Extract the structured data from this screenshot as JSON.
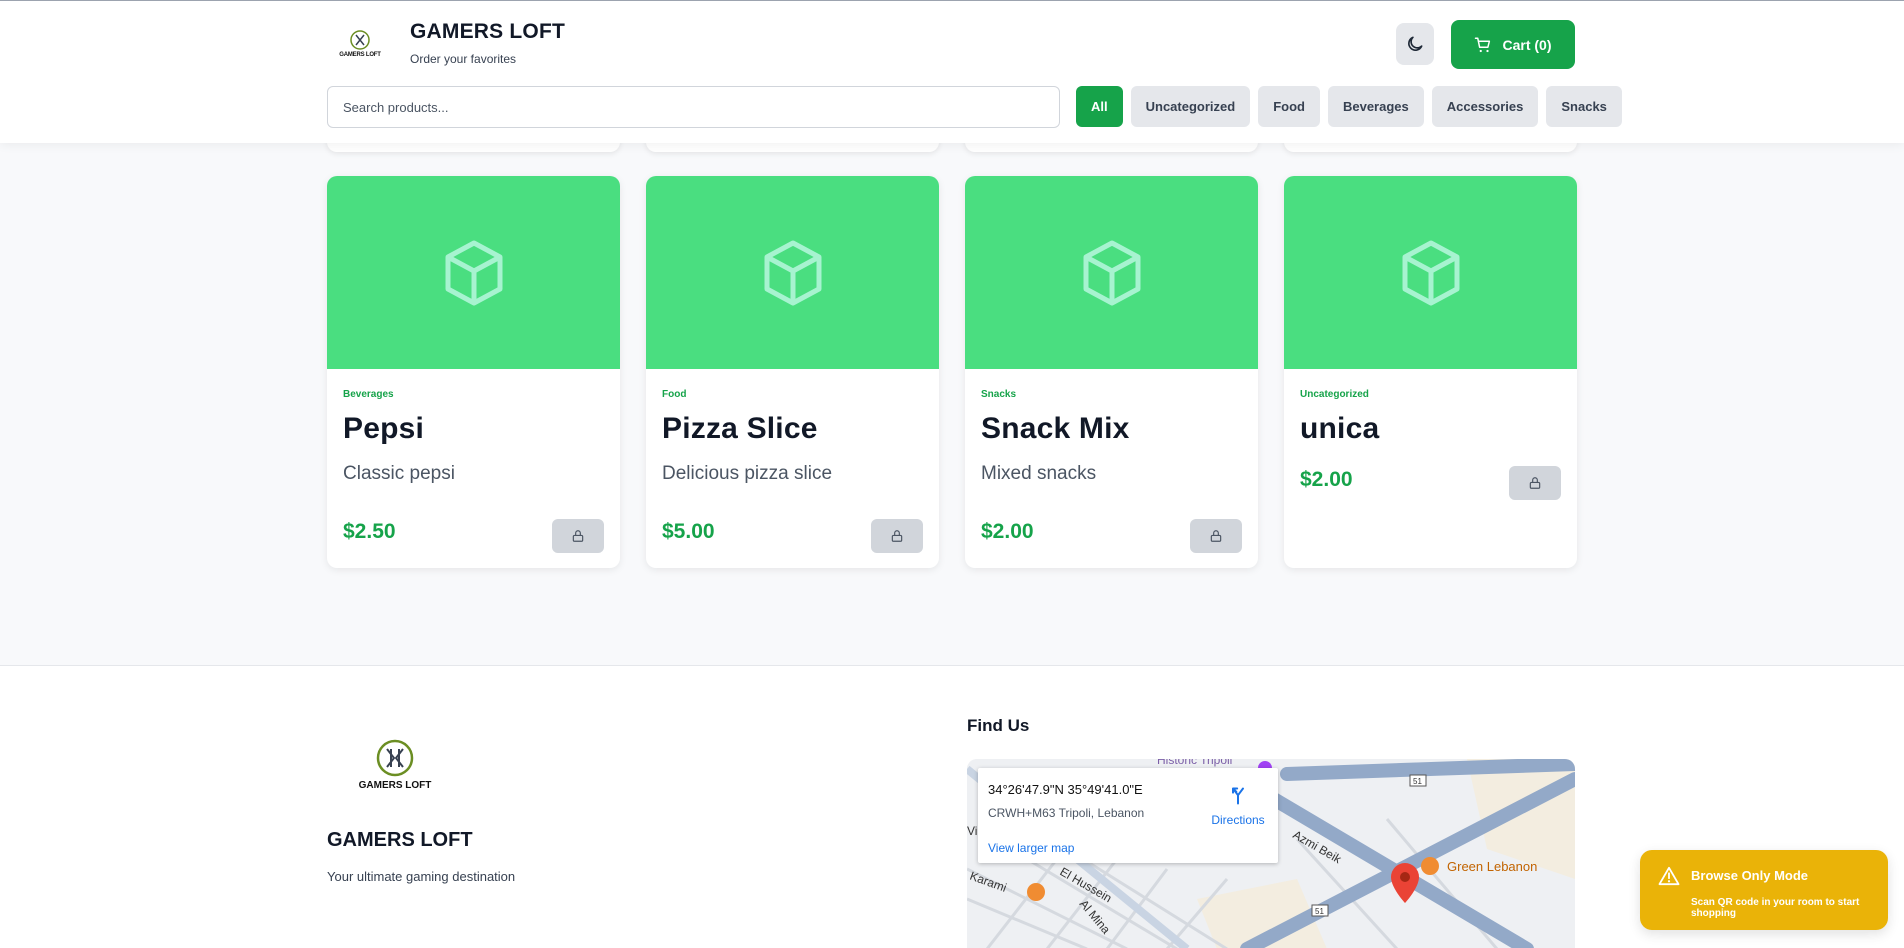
{
  "header": {
    "brand_logo_text": "GAMERS LOFT",
    "title": "GAMERS LOFT",
    "subtitle": "Order your favorites",
    "theme_toggle_icon": "moon-icon",
    "cart_icon": "cart-icon",
    "cart_label": "Cart (0)",
    "accent_color": "#16a34a"
  },
  "search": {
    "placeholder": "Search products...",
    "value": ""
  },
  "filters": [
    {
      "label": "All",
      "active": true
    },
    {
      "label": "Uncategorized",
      "active": false
    },
    {
      "label": "Food",
      "active": false
    },
    {
      "label": "Beverages",
      "active": false
    },
    {
      "label": "Accessories",
      "active": false
    },
    {
      "label": "Snacks",
      "active": false
    }
  ],
  "products": [
    {
      "category": "Beverages",
      "name": "Pepsi",
      "description": "Classic pepsi",
      "price": "$2.50",
      "image_icon": "box-icon",
      "action_icon": "lock-icon"
    },
    {
      "category": "Food",
      "name": "Pizza Slice",
      "description": "Delicious pizza slice",
      "price": "$5.00",
      "image_icon": "box-icon",
      "action_icon": "lock-icon"
    },
    {
      "category": "Snacks",
      "name": "Snack Mix",
      "description": "Mixed snacks",
      "price": "$2.00",
      "image_icon": "box-icon",
      "action_icon": "lock-icon"
    },
    {
      "category": "Uncategorized",
      "name": "unica",
      "description": "",
      "price": "$2.00",
      "image_icon": "box-icon",
      "action_icon": "lock-icon"
    }
  ],
  "footer": {
    "logo_text": "GAMERS LOFT",
    "title": "GAMERS LOFT",
    "tagline": "Your ultimate gaming destination",
    "find_us_heading": "Find Us",
    "map": {
      "coords": "34°26'47.9\"N 35°49'41.0\"E",
      "address": "CRWH+M63 Tripoli, Lebanon",
      "directions_label": "Directions",
      "view_larger_label": "View larger map",
      "labels": [
        "Historic Tripoli",
        "Azmi Beik",
        "El Hussein",
        "Al Mina",
        "Karami",
        "Green Lebanon",
        "51",
        "Vi"
      ]
    }
  },
  "toast": {
    "icon": "warning-icon",
    "title": "Browse Only Mode",
    "message": "Scan QR code in your room to start shopping",
    "color": "#eab308"
  }
}
